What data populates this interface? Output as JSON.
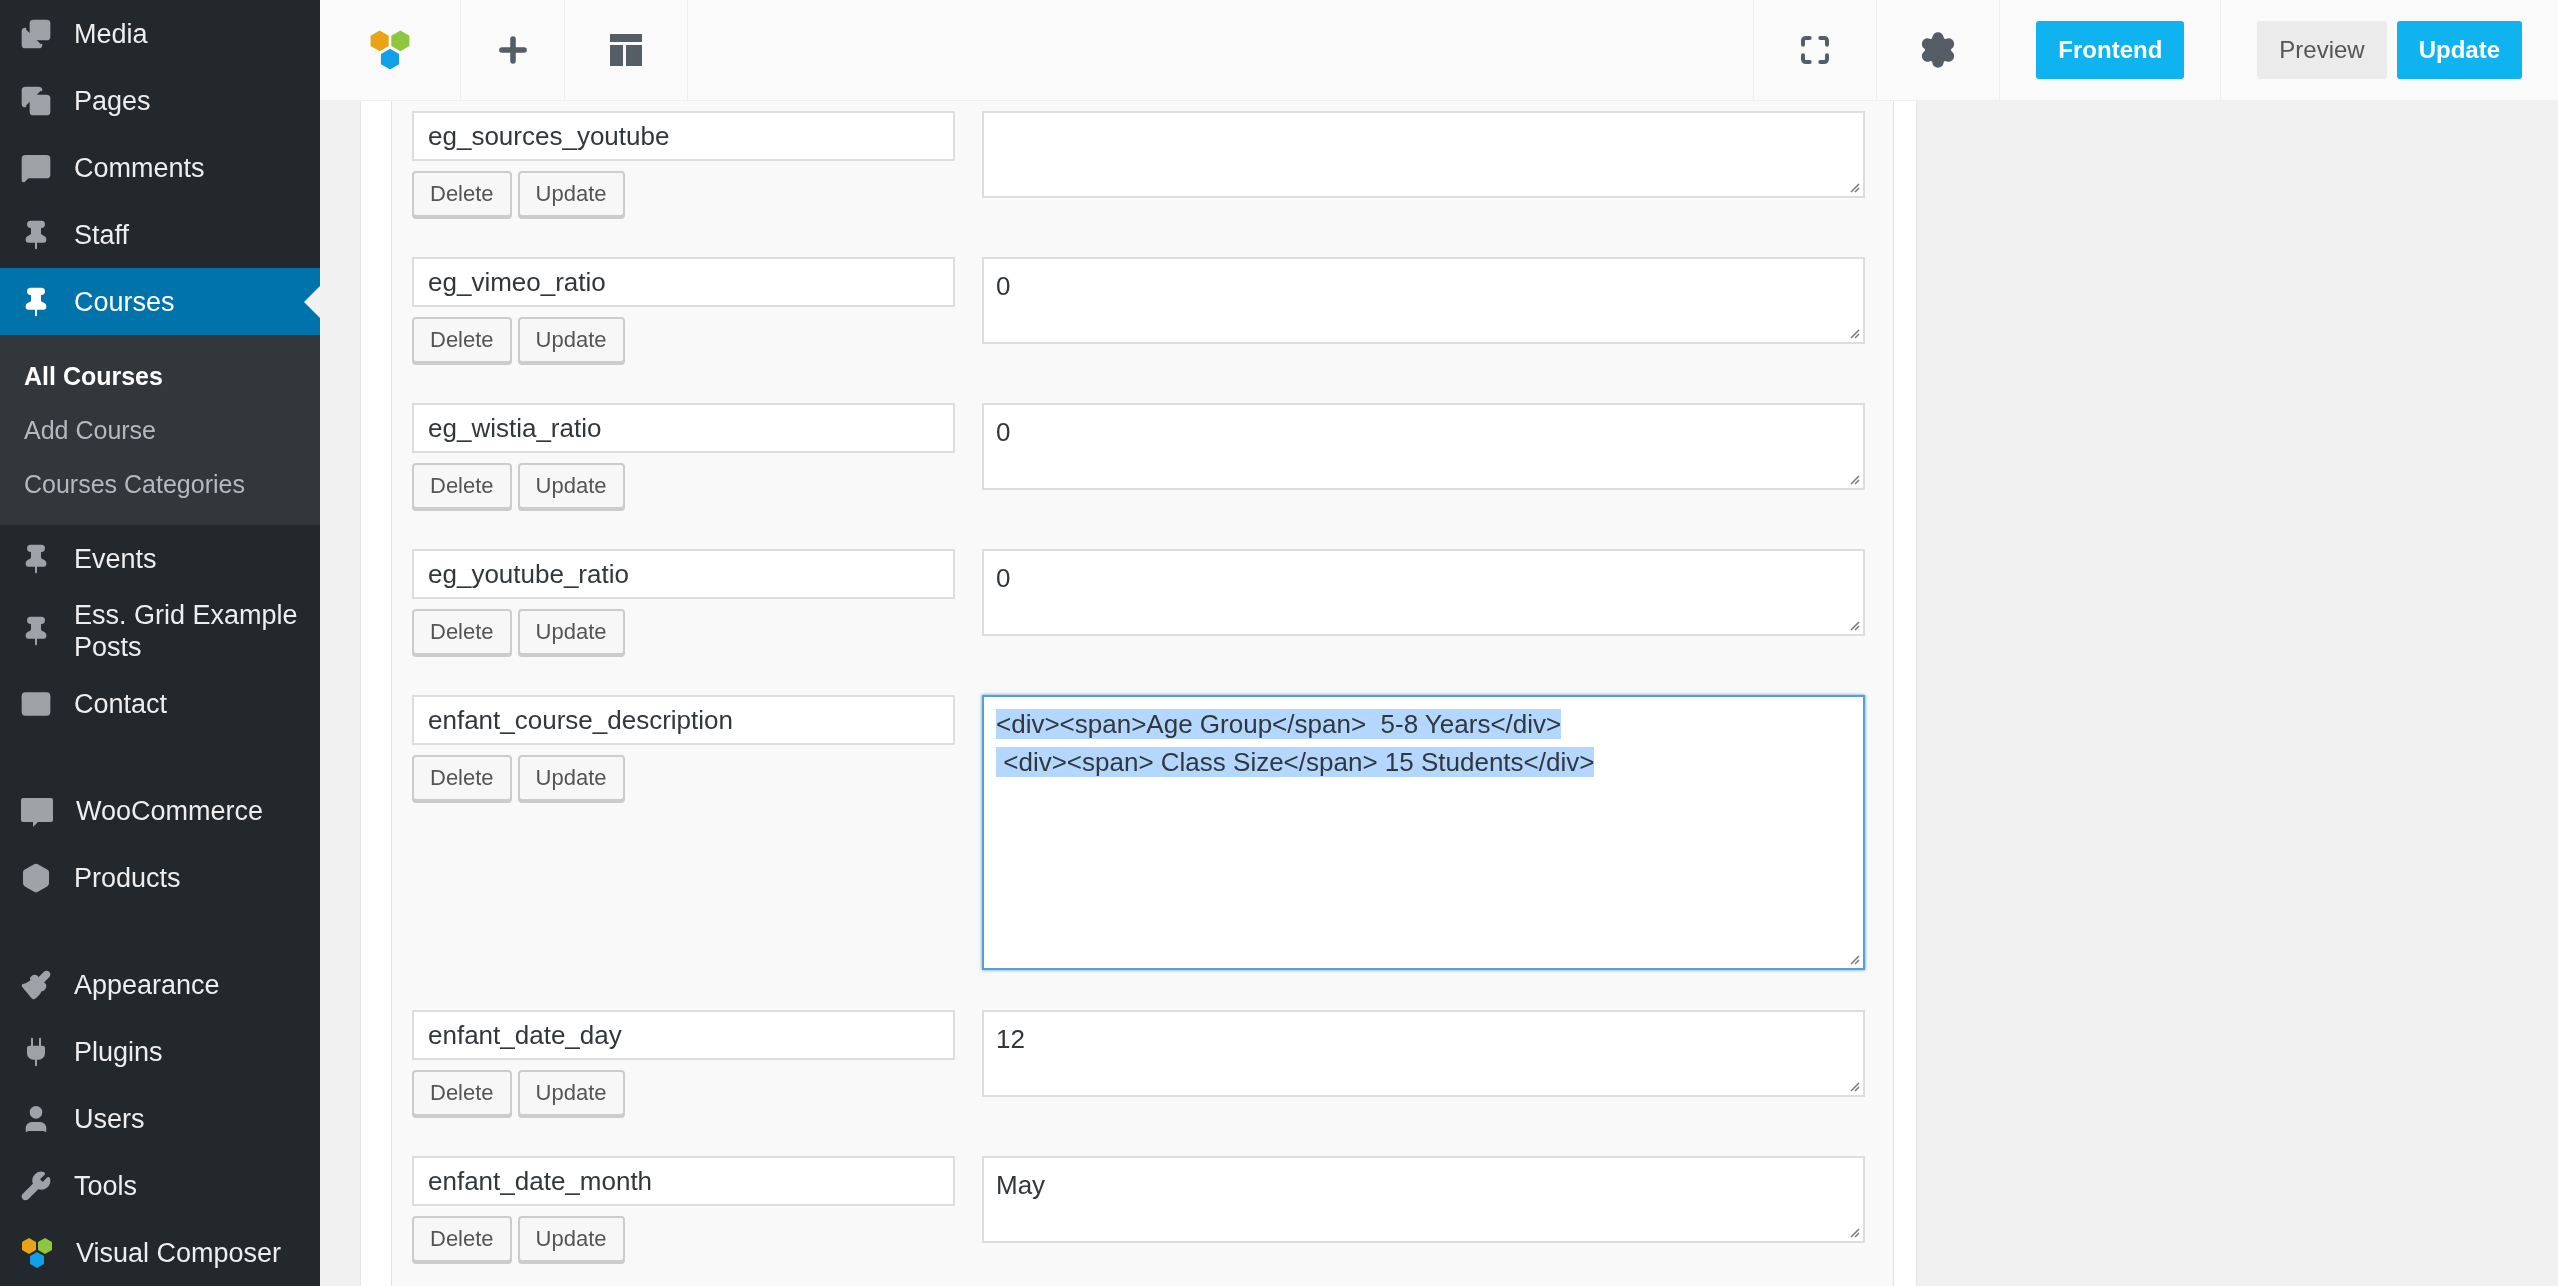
{
  "sidebar": {
    "items": [
      {
        "label": "Media",
        "selected": false
      },
      {
        "label": "Pages",
        "selected": false
      },
      {
        "label": "Comments",
        "selected": false
      },
      {
        "label": "Staff",
        "selected": false
      },
      {
        "label": "Courses",
        "selected": true,
        "children": [
          {
            "label": "All Courses",
            "selected": true
          },
          {
            "label": "Add Course",
            "selected": false
          },
          {
            "label": "Courses Categories",
            "selected": false
          }
        ]
      },
      {
        "label": "Events",
        "selected": false
      },
      {
        "label": "Ess. Grid Example Posts",
        "selected": false
      },
      {
        "label": "Contact",
        "selected": false
      },
      {
        "label": "WooCommerce",
        "selected": false
      },
      {
        "label": "Products",
        "selected": false
      },
      {
        "label": "Appearance",
        "selected": false
      },
      {
        "label": "Plugins",
        "selected": false
      },
      {
        "label": "Users",
        "selected": false
      },
      {
        "label": "Tools",
        "selected": false
      },
      {
        "label": "Visual Composer",
        "selected": false
      }
    ]
  },
  "toolbar": {
    "frontend_button": "Frontend",
    "preview_button": "Preview",
    "update_button": "Update"
  },
  "custom_fields": [
    {
      "key": "eg_sources_youtube",
      "tall": false,
      "focused": false,
      "delete_button": "Delete",
      "update_button": "Update"
    },
    {
      "key": "eg_vimeo_ratio",
      "value": "0",
      "tall": false,
      "focused": false,
      "delete_button": "Delete",
      "update_button": "Update"
    },
    {
      "key": "eg_wistia_ratio",
      "value": "0",
      "tall": false,
      "focused": false,
      "delete_button": "Delete",
      "update_button": "Update"
    },
    {
      "key": "eg_youtube_ratio",
      "value": "0",
      "tall": false,
      "focused": false,
      "delete_button": "Delete",
      "update_button": "Update"
    },
    {
      "key": "enfant_course_description",
      "value": "<div><span>Age Group</span>  5-8 Years</div>\n <div><span> Class Size</span> 15 Students</div>",
      "tall": true,
      "focused": true,
      "delete_button": "Delete",
      "update_button": "Update"
    },
    {
      "key": "enfant_date_day",
      "value": "12",
      "tall": false,
      "focused": false,
      "delete_button": "Delete",
      "update_button": "Update"
    },
    {
      "key": "enfant_date_month",
      "value": "May",
      "tall": false,
      "focused": false,
      "delete_button": "Delete",
      "update_button": "Update"
    }
  ]
}
